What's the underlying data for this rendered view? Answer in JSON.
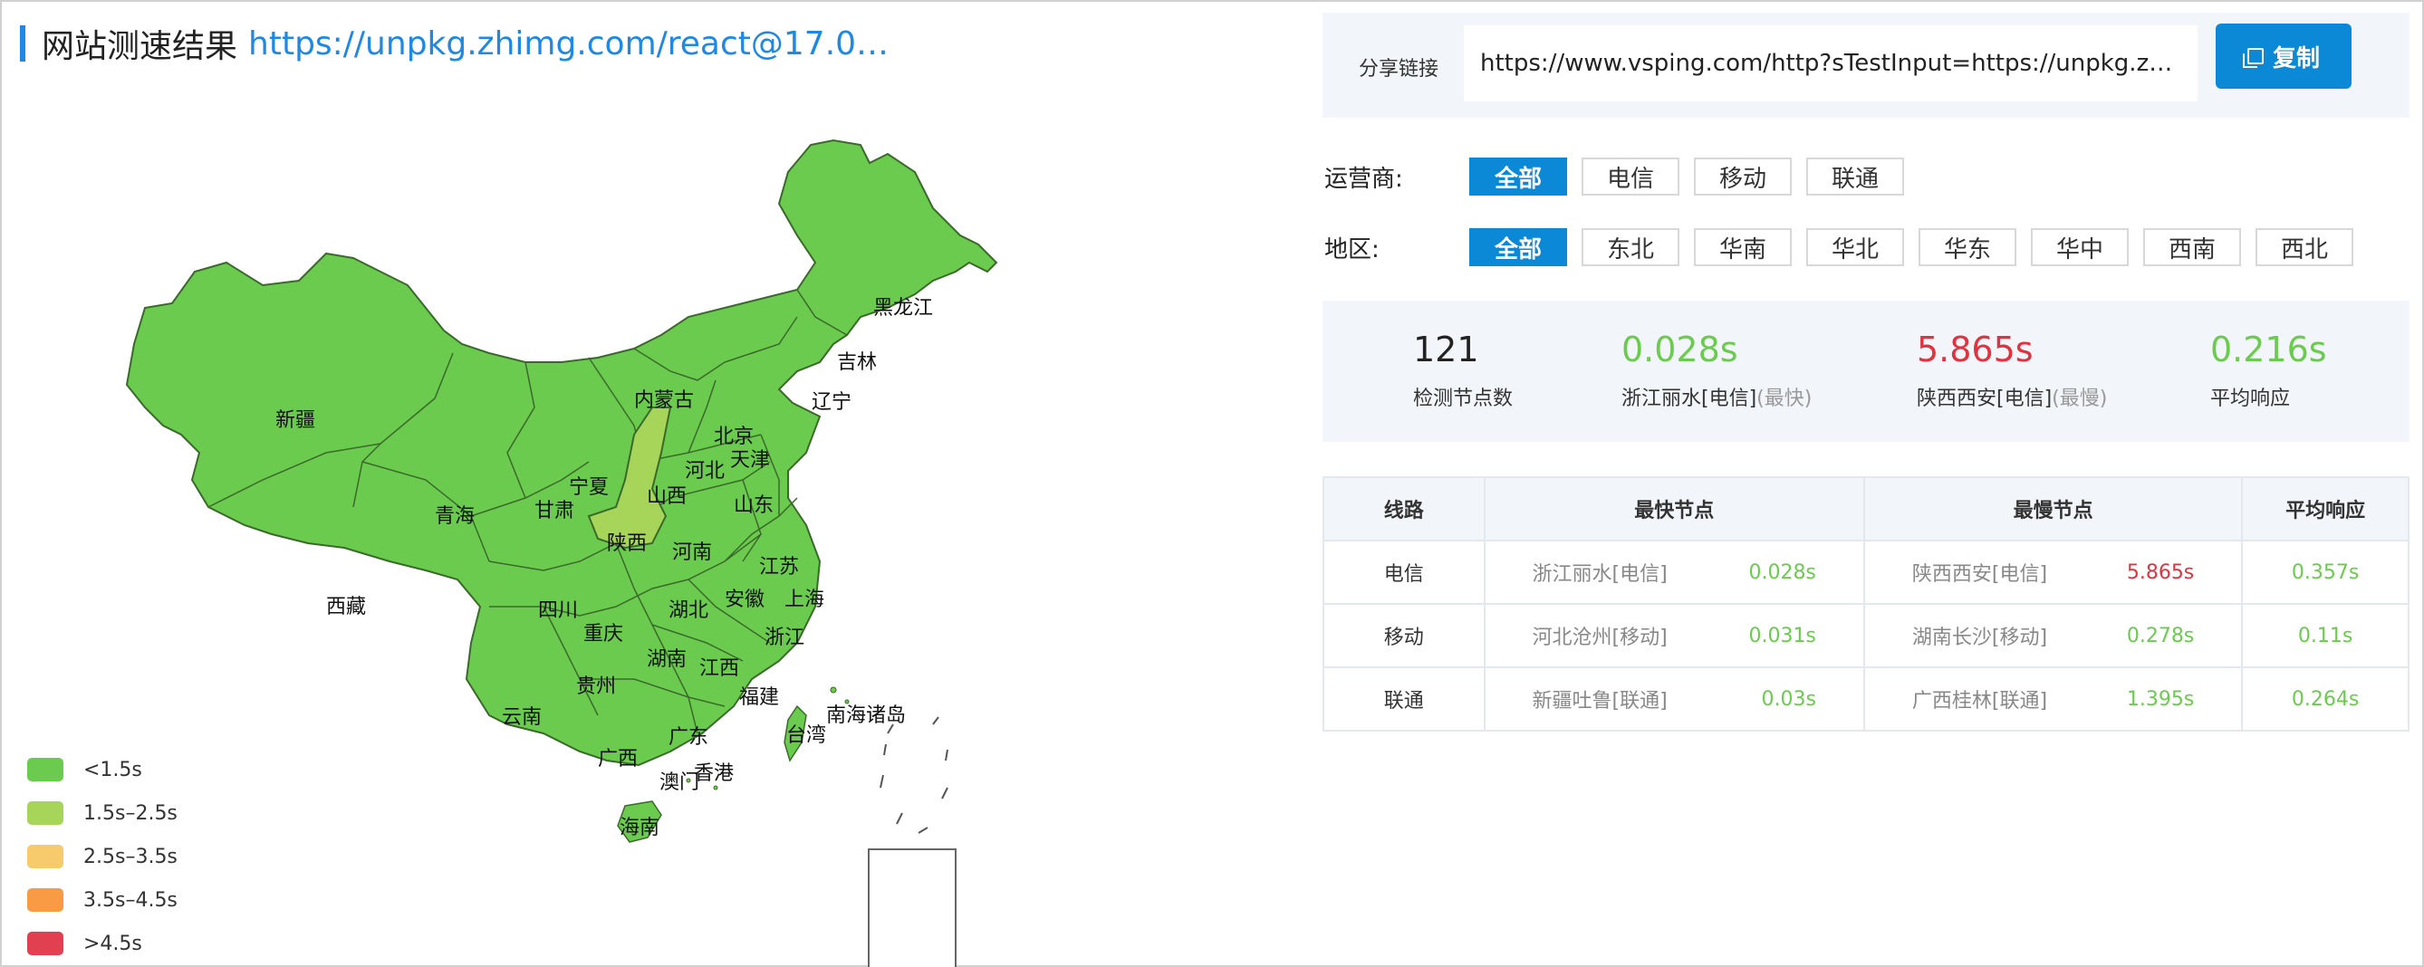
{
  "header": {
    "title": "网站测速结果",
    "url": "https://unpkg.zhimg.com/react@17.0…"
  },
  "map": {
    "provinces": [
      "新疆",
      "西藏",
      "青海",
      "甘肃",
      "宁夏",
      "内蒙古",
      "黑龙江",
      "吉林",
      "辽宁",
      "北京",
      "天津",
      "河北",
      "山西",
      "山东",
      "陕西",
      "河南",
      "江苏",
      "上海",
      "安徽",
      "湖北",
      "四川",
      "重庆",
      "浙江",
      "湖南",
      "江西",
      "贵州",
      "福建",
      "云南",
      "广西",
      "广东",
      "台湾",
      "香港",
      "澳门",
      "海南",
      "南海诸岛"
    ],
    "colors": {
      "fast": "#6bcb4e",
      "mid": "#a6d55a",
      "border": "#3a6a2a"
    }
  },
  "legend": [
    {
      "label": "<1.5s",
      "color": "#6bcb4e"
    },
    {
      "label": "1.5s–2.5s",
      "color": "#a6d55a"
    },
    {
      "label": "2.5s–3.5s",
      "color": "#f7cb6b"
    },
    {
      "label": "3.5s–4.5s",
      "color": "#f99a45"
    },
    {
      "label": ">4.5s",
      "color": "#e04050"
    }
  ],
  "share": {
    "label": "分享链接",
    "value": "https://www.vsping.com/http?sTestInput=https://unpkg.zhim…",
    "copy_label": "复制"
  },
  "filters": {
    "isp_label": "运营商:",
    "isp": [
      "全部",
      "电信",
      "移动",
      "联通"
    ],
    "region_label": "地区:",
    "region": [
      "全部",
      "东北",
      "华南",
      "华北",
      "华东",
      "华中",
      "西南",
      "西北"
    ]
  },
  "stats": {
    "nodes": {
      "value": "121",
      "label": "检测节点数"
    },
    "fastest": {
      "value": "0.028s",
      "label": "浙江丽水[电信]",
      "tag": "(最快)"
    },
    "slowest": {
      "value": "5.865s",
      "label": "陕西西安[电信]",
      "tag": "(最慢)"
    },
    "average": {
      "value": "0.216s",
      "label": "平均响应"
    },
    "colors": {
      "green": "#6bcb4e",
      "red": "#e0333f"
    }
  },
  "table": {
    "headers": [
      "线路",
      "最快节点",
      "最慢节点",
      "平均响应"
    ],
    "rows": [
      {
        "line": "电信",
        "fast_node": "浙江丽水[电信]",
        "fast_val": "0.028s",
        "slow_node": "陕西西安[电信]",
        "slow_val": "5.865s",
        "avg": "0.357s"
      },
      {
        "line": "移动",
        "fast_node": "河北沧州[移动]",
        "fast_val": "0.031s",
        "slow_node": "湖南长沙[移动]",
        "slow_val": "0.278s",
        "avg": "0.11s"
      },
      {
        "line": "联通",
        "fast_node": "新疆吐鲁[联通]",
        "fast_val": "0.03s",
        "slow_node": "广西桂林[联通]",
        "slow_val": "1.395s",
        "avg": "0.264s"
      }
    ]
  }
}
